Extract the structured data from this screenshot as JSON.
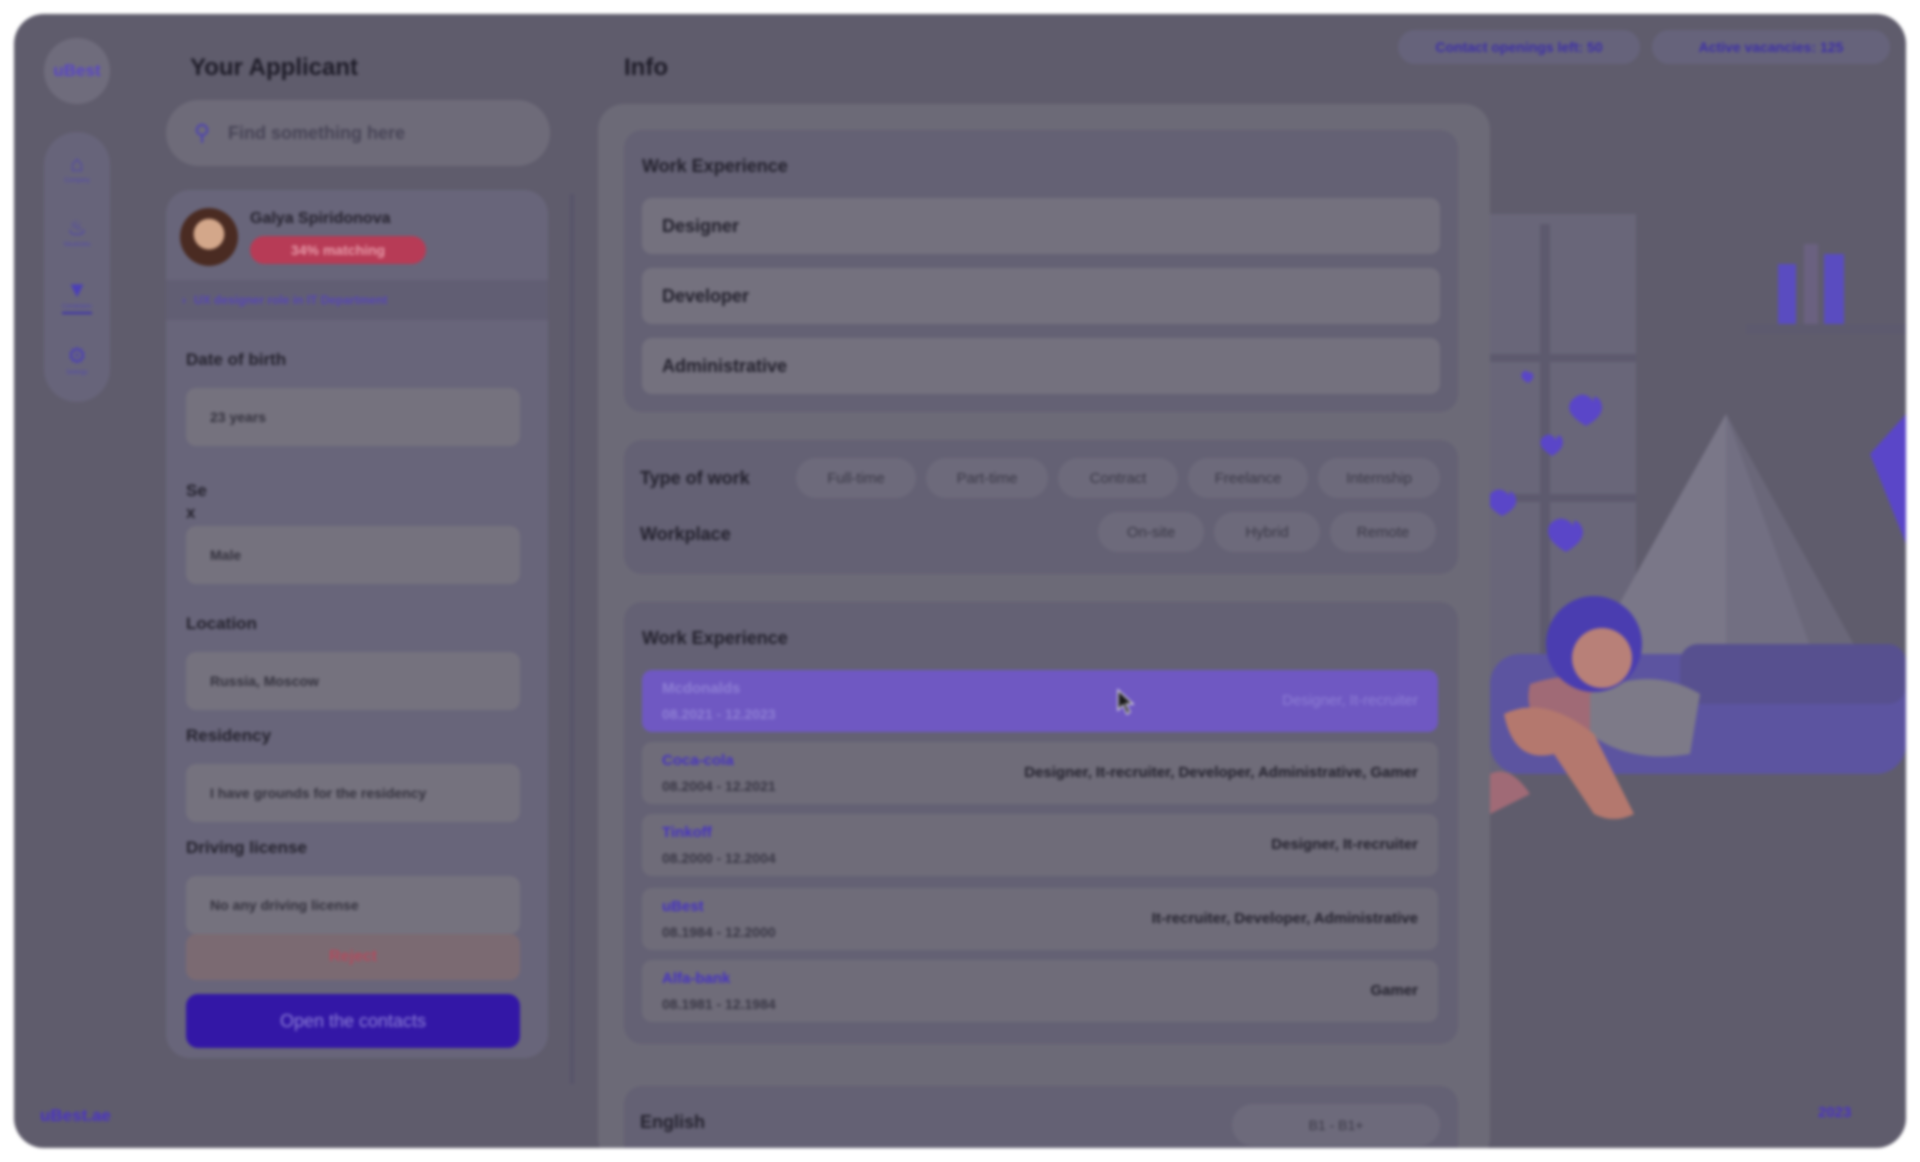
{
  "app": {
    "logo_text": "uBest",
    "footer_domain": "uBest.ae",
    "footer_year": "2023"
  },
  "sidebar": {
    "items": [
      {
        "label": "Company",
        "icon": "home-icon"
      },
      {
        "label": "Vacancies",
        "icon": "flame-icon"
      },
      {
        "label": "Candidates",
        "icon": "mask-icon"
      },
      {
        "label": "Settings",
        "icon": "gear-icon"
      }
    ]
  },
  "header": {
    "contact_openings": "Contact openings left: 50",
    "active_vacancies": "Active vacancies: 125"
  },
  "applicant": {
    "section_title": "Your Applicant",
    "search_placeholder": "Find something here",
    "name": "Galya Spiridonova",
    "matching": "34% matching",
    "role": "UX designer role in IT Department",
    "fields": [
      {
        "label": "Date of birth",
        "value": "23 years"
      },
      {
        "label": "Se\nx",
        "value": "Male"
      },
      {
        "label": "Location",
        "value": "Russia, Moscow"
      },
      {
        "label": "Residency",
        "value": "I have grounds for the residency"
      },
      {
        "label": "Driving license",
        "value": "No any driving license"
      }
    ],
    "reject_label": "Reject",
    "open_contacts_label": "Open the contacts"
  },
  "info": {
    "title": "Info",
    "work_experience_title": "Work Experience",
    "categories": [
      "Designer",
      "Developer",
      "Administrative"
    ],
    "type_of_work_label": "Type of work",
    "type_of_work": [
      "Full-time",
      "Part-time",
      "Contract",
      "Freelance",
      "Internship"
    ],
    "workplace_label": "Workplace",
    "workplace": [
      "On-site",
      "Hybrid",
      "Remote"
    ],
    "jobs_title": "Work Experience",
    "jobs": [
      {
        "company": "Mcdonalds",
        "dates": "08.2021 - 12.2023",
        "roles": "Designer, It-recruiter"
      },
      {
        "company": "Coca-cola",
        "dates": "08.2004 - 12.2021",
        "roles": "Designer, It-recruiter, Developer, Administrative, Gamer"
      },
      {
        "company": "Tinkoff",
        "dates": "08.2000 - 12.2004",
        "roles": "Designer, It-recruiter"
      },
      {
        "company": "uBest",
        "dates": "08.1984 - 12.2000",
        "roles": "It-recruiter, Developer, Administrative"
      },
      {
        "company": "Alfa-bank",
        "dates": "08.1981 - 12.1984",
        "roles": "Gamer"
      }
    ],
    "language": "English",
    "language_level": "B1 - B1+"
  },
  "colors": {
    "accent": "#3317a6",
    "brand": "#4b33c8",
    "danger": "#b73b56",
    "overlay": "#5f5c6c"
  }
}
